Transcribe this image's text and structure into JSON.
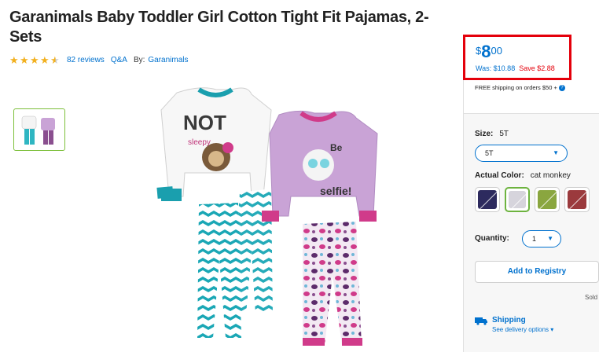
{
  "product": {
    "title": "Garanimals Baby Toddler Girl Cotton Tight Fit Pajamas, 2-Sets",
    "rating": 4.5,
    "reviews_label": "82 reviews",
    "qa_label": "Q&A",
    "by_label": "By:",
    "brand": "Garanimals"
  },
  "price": {
    "currency": "$",
    "dollars": "8",
    "cents": "00",
    "was_label": "Was: $10.88",
    "save_label": "Save $2.88",
    "shipping_note": "FREE shipping on orders $50 +",
    "help_icon": "?"
  },
  "options": {
    "size_label": "Size:",
    "size_value": "5T",
    "size_selected": "5T",
    "color_label": "Actual Color:",
    "color_value": "cat monkey",
    "swatches": [
      {
        "name": "navy",
        "color": "#2d2a5e"
      },
      {
        "name": "cat monkey",
        "color": "#d6d4dc"
      },
      {
        "name": "green",
        "color": "#8aa63f"
      },
      {
        "name": "red",
        "color": "#9b3a3d"
      }
    ],
    "quantity_label": "Quantity:",
    "quantity_value": "1"
  },
  "actions": {
    "registry_label": "Add to Registry",
    "sold_label": "Sold",
    "shipping_label": "Shipping",
    "delivery_options_label": "See delivery options"
  },
  "colors": {
    "accent": "#0071ce",
    "sale": "#e4000b",
    "star": "#f2b01e"
  }
}
